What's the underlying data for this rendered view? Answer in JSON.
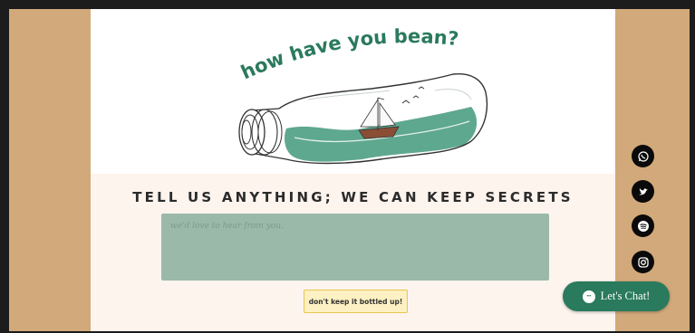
{
  "hero": {
    "tagline": "how have you bean?",
    "illustration": "ship-in-a-bottle"
  },
  "form": {
    "heading": "TELL US ANYTHING; WE CAN KEEP SECRETS",
    "message_placeholder": "we'd love to hear from you.",
    "submit_label": "don't keep it bottled up!"
  },
  "social": [
    {
      "name": "whatsapp-icon"
    },
    {
      "name": "twitter-icon"
    },
    {
      "name": "spotify-icon"
    },
    {
      "name": "instagram-icon"
    },
    {
      "name": "social-icon"
    }
  ],
  "chat": {
    "label": "Let's Chat!"
  },
  "colors": {
    "tan": "#d2a97a",
    "green": "#2a7a5d",
    "message_box": "#9bb9a9",
    "button_yellow": "#fdf0c2",
    "form_bg": "#fdf4ee"
  }
}
